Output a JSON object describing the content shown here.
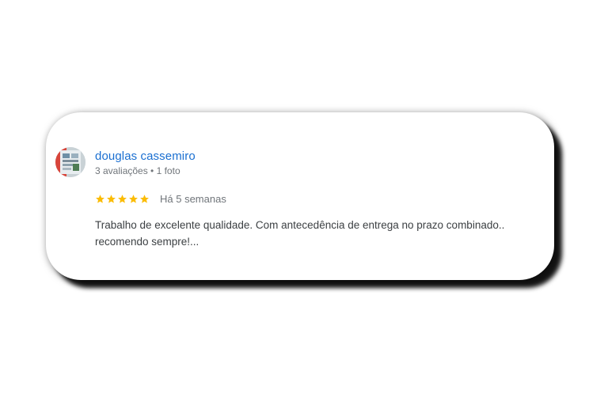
{
  "review": {
    "reviewer_name": "douglas cassemiro",
    "reviewer_reviews": "3 avaliações",
    "separator": " • ",
    "reviewer_photos": "1 foto",
    "rating": 5,
    "rating_max": 5,
    "date": "Há 5 semanas",
    "text": "Trabalho de excelente qualidade. Com antecedência de entrega no prazo combinado.. recomendo sempre!..."
  },
  "colors": {
    "name_link": "#1a6fd1",
    "meta_text": "#70757a",
    "body_text": "#3c4043",
    "star_filled": "#fbbc04",
    "card_shadow": "#000000"
  },
  "icons": {
    "avatar": "avatar-photo",
    "star": "star-icon"
  }
}
